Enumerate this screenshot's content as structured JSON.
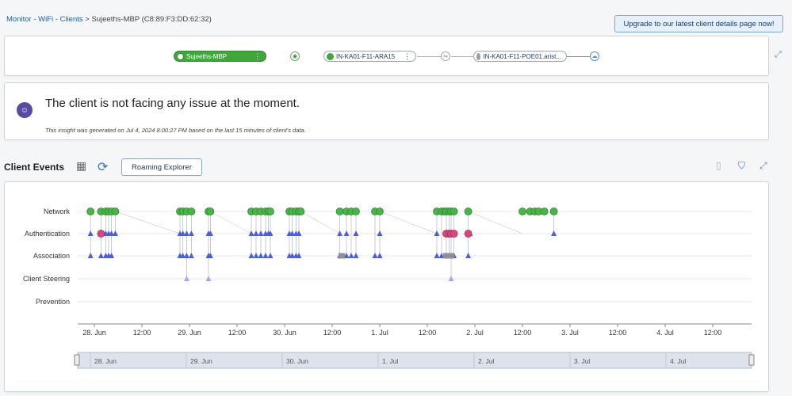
{
  "breadcrumb": {
    "monitor": "Monitor",
    "wifi": "WiFi",
    "clients": "Clients",
    "separator1": " - ",
    "separator2": " - ",
    "arrow": " > ",
    "current": "Sujeeths-MBP (C8:89:F3:DD:62:32)"
  },
  "upgrade_button": "Upgrade to our latest client details page now!",
  "topology": {
    "client": "Sujeeths-MBP",
    "ap": "IN-KA01-F11-ARA15",
    "switch": "IN-KA01-F11-POE01.arist...",
    "kebab": "⋮"
  },
  "insight": {
    "title": "The client is not facing any issue at the moment.",
    "subtitle": "This insight was generated on Jul 4, 2024 8:00:27 PM based on the last 15 minutes of client's data."
  },
  "events": {
    "title": "Client Events",
    "roaming_button": "Roaming Explorer"
  },
  "colors": {
    "green": "#49b548",
    "red": "#d9477a",
    "blue": "#4a5ee0",
    "lightblue": "#a7a9ee",
    "gray": "#8f8f96",
    "accent": "#1f5fa8"
  },
  "chart_data": {
    "type": "scatter",
    "rows": [
      "Network",
      "Authentication",
      "Association",
      "Client Steering",
      "Prevention"
    ],
    "x_ticks": [
      "28. Jun",
      "12:00",
      "29. Jun",
      "12:00",
      "30. Jun",
      "12:00",
      "1. Jul",
      "12:00",
      "2. Jul",
      "12:00",
      "3. Jul",
      "12:00",
      "4. Jul",
      "12:00"
    ],
    "navigator_ticks": [
      "28. Jun",
      "29. Jun",
      "30. Jun",
      "1. Jul",
      "2. Jul",
      "3. Jul",
      "4. Jul"
    ],
    "x_range_days": [
      27.9,
      4.85
    ],
    "series": [
      {
        "row": "Network",
        "marker": "circle-green",
        "days": [
          27.96,
          28.07,
          28.12,
          28.15,
          28.18,
          28.22,
          28.9,
          28.93,
          28.97,
          29.02,
          29.2,
          29.22,
          29.65,
          29.7,
          29.75,
          29.8,
          29.83,
          29.85,
          30.05,
          30.08,
          30.12,
          30.15,
          30.17,
          30.58,
          30.65,
          30.7,
          30.75,
          30.95,
          31.0,
          31.6,
          31.65,
          31.68,
          31.7,
          31.73,
          31.75,
          31.78,
          31.93,
          32.5,
          32.58,
          32.63,
          32.67,
          32.73,
          32.83
        ]
      },
      {
        "row": "Authentication",
        "marker": "triangle-blue",
        "days": [
          27.96,
          28.12,
          28.15,
          28.18,
          28.22,
          28.9,
          28.93,
          28.97,
          29.02,
          29.2,
          29.22,
          29.65,
          29.7,
          29.75,
          29.8,
          29.83,
          29.85,
          30.05,
          30.08,
          30.12,
          30.15,
          30.58,
          30.65,
          30.75,
          31.0,
          31.6,
          31.95,
          32.83
        ]
      },
      {
        "row": "Authentication",
        "marker": "circle-red",
        "days": [
          28.07,
          31.7,
          31.73,
          31.75,
          31.78,
          31.93
        ]
      },
      {
        "row": "Association",
        "marker": "triangle-blue",
        "days": [
          27.96,
          28.07,
          28.12,
          28.15,
          28.18,
          28.9,
          28.93,
          28.97,
          29.02,
          29.2,
          29.22,
          29.65,
          29.7,
          29.75,
          29.8,
          29.85,
          30.05,
          30.08,
          30.12,
          30.15,
          30.58,
          30.65,
          30.7,
          30.75,
          30.95,
          31.0,
          31.6,
          31.65,
          31.73,
          31.78,
          31.93
        ]
      },
      {
        "row": "Association",
        "marker": "square-gray",
        "days": [
          30.6,
          31.7,
          31.72,
          31.75
        ]
      },
      {
        "row": "Client Steering",
        "marker": "triangle-lightblue",
        "days": [
          28.97,
          29.2,
          31.75
        ]
      }
    ]
  }
}
